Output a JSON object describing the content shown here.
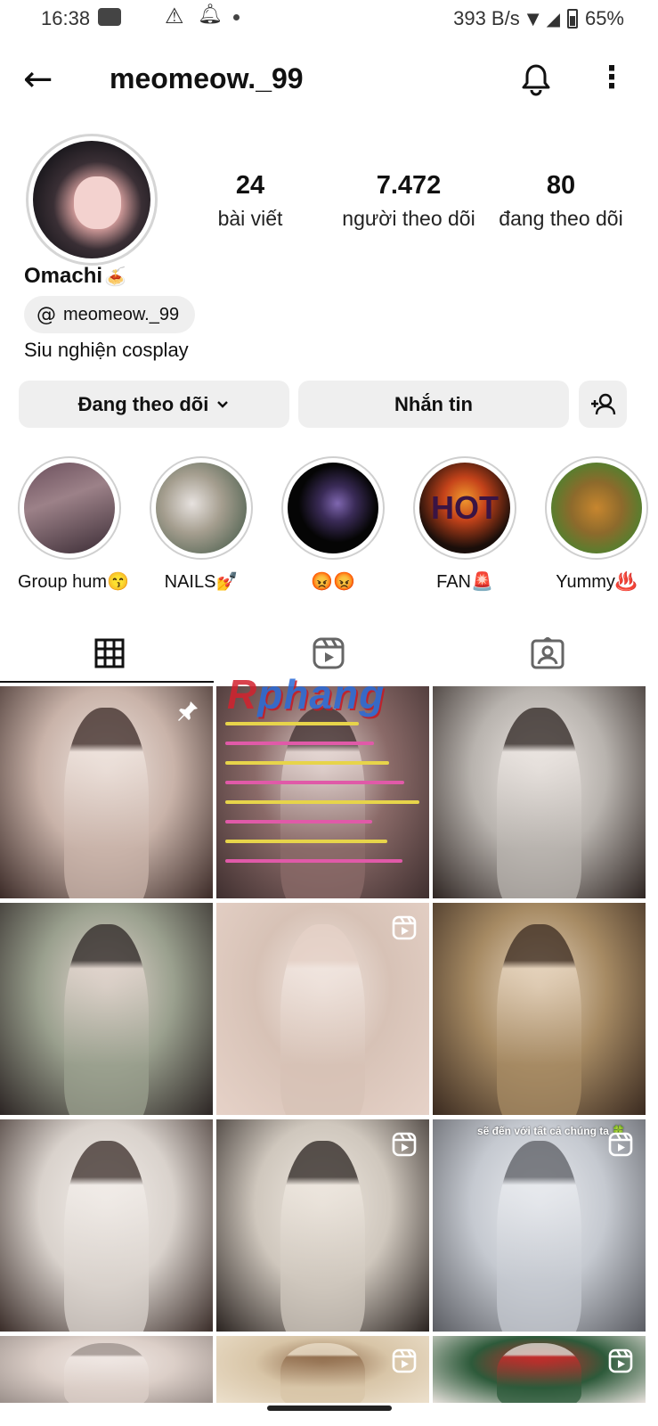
{
  "status_bar": {
    "time": "16:38",
    "net_speed": "393 B/s",
    "battery": "65%",
    "icons": [
      "youtube-icon",
      "warning-icon",
      "bell-icon",
      "dot-icon",
      "data-icon",
      "signal-icon",
      "battery-icon"
    ]
  },
  "header": {
    "username": "meomeow._99",
    "icons": [
      "back-arrow-icon",
      "notification-bell-icon",
      "more-icon"
    ]
  },
  "profile": {
    "display_name": "Omachi",
    "display_name_emoji": "🍝",
    "threads_handle": "meomeow._99",
    "bio": "Siu nghiện cosplay",
    "stats": [
      {
        "number": "24",
        "label": "bài viết"
      },
      {
        "number": "7.472",
        "label": "người theo dõi"
      },
      {
        "number": "80",
        "label": "đang theo dõi"
      }
    ]
  },
  "actions": {
    "following_label": "Đang theo dõi",
    "message_label": "Nhắn tin"
  },
  "highlights": [
    {
      "label": "Group hum😙"
    },
    {
      "label": "NAILS💅"
    },
    {
      "label": "😡😡"
    },
    {
      "label": "FAN🚨"
    },
    {
      "label": "Yummy♨️"
    }
  ],
  "tabs": [
    "grid-icon",
    "reels-icon",
    "tagged-icon"
  ],
  "watermark": {
    "first": "R",
    "rest": "phang"
  },
  "grid_posts": [
    {
      "type": "pinned",
      "colors": [
        "#c9b3a9",
        "#efe4de",
        "#3b2a27"
      ]
    },
    {
      "type": "text-post",
      "colors": [
        "#8a6a68",
        "#e9dcd8",
        "#3f2f2f"
      ]
    },
    {
      "type": "photo",
      "colors": [
        "#b8b3ae",
        "#ece6e2",
        "#2e2522"
      ]
    },
    {
      "type": "photo",
      "colors": [
        "#9aa08e",
        "#e3d6cf",
        "#2c2524"
      ]
    },
    {
      "type": "reel",
      "colors": [
        "#d7c2b6",
        "#f1e6e0",
        "#e6d2c8"
      ]
    },
    {
      "type": "photo",
      "colors": [
        "#a68a63",
        "#e7d5bf",
        "#3a2a20"
      ]
    },
    {
      "type": "photo",
      "colors": [
        "#d9d2cc",
        "#f2ede9",
        "#3a2d29"
      ]
    },
    {
      "type": "reel",
      "colors": [
        "#cfc7bd",
        "#eee7df",
        "#2a2320"
      ]
    },
    {
      "type": "reel",
      "colors": [
        "#c5c9d0",
        "#e9ebef",
        "#5b5d63"
      ]
    },
    {
      "type": "partial",
      "colors": [
        "#dccfc8",
        "#f0e8e4",
        "#9a8f8a"
      ]
    },
    {
      "type": "partial-reel",
      "colors": [
        "#d8c5a7",
        "#8f6b4b",
        "#ece0cc"
      ]
    },
    {
      "type": "partial-reel",
      "colors": [
        "#2d5a3a",
        "#c92a2a",
        "#e8e2dd"
      ]
    }
  ],
  "caption_overlay": "sẽ đến với tất cả chúng ta 🍀",
  "highlight_text": {
    "hot": "HOT"
  }
}
